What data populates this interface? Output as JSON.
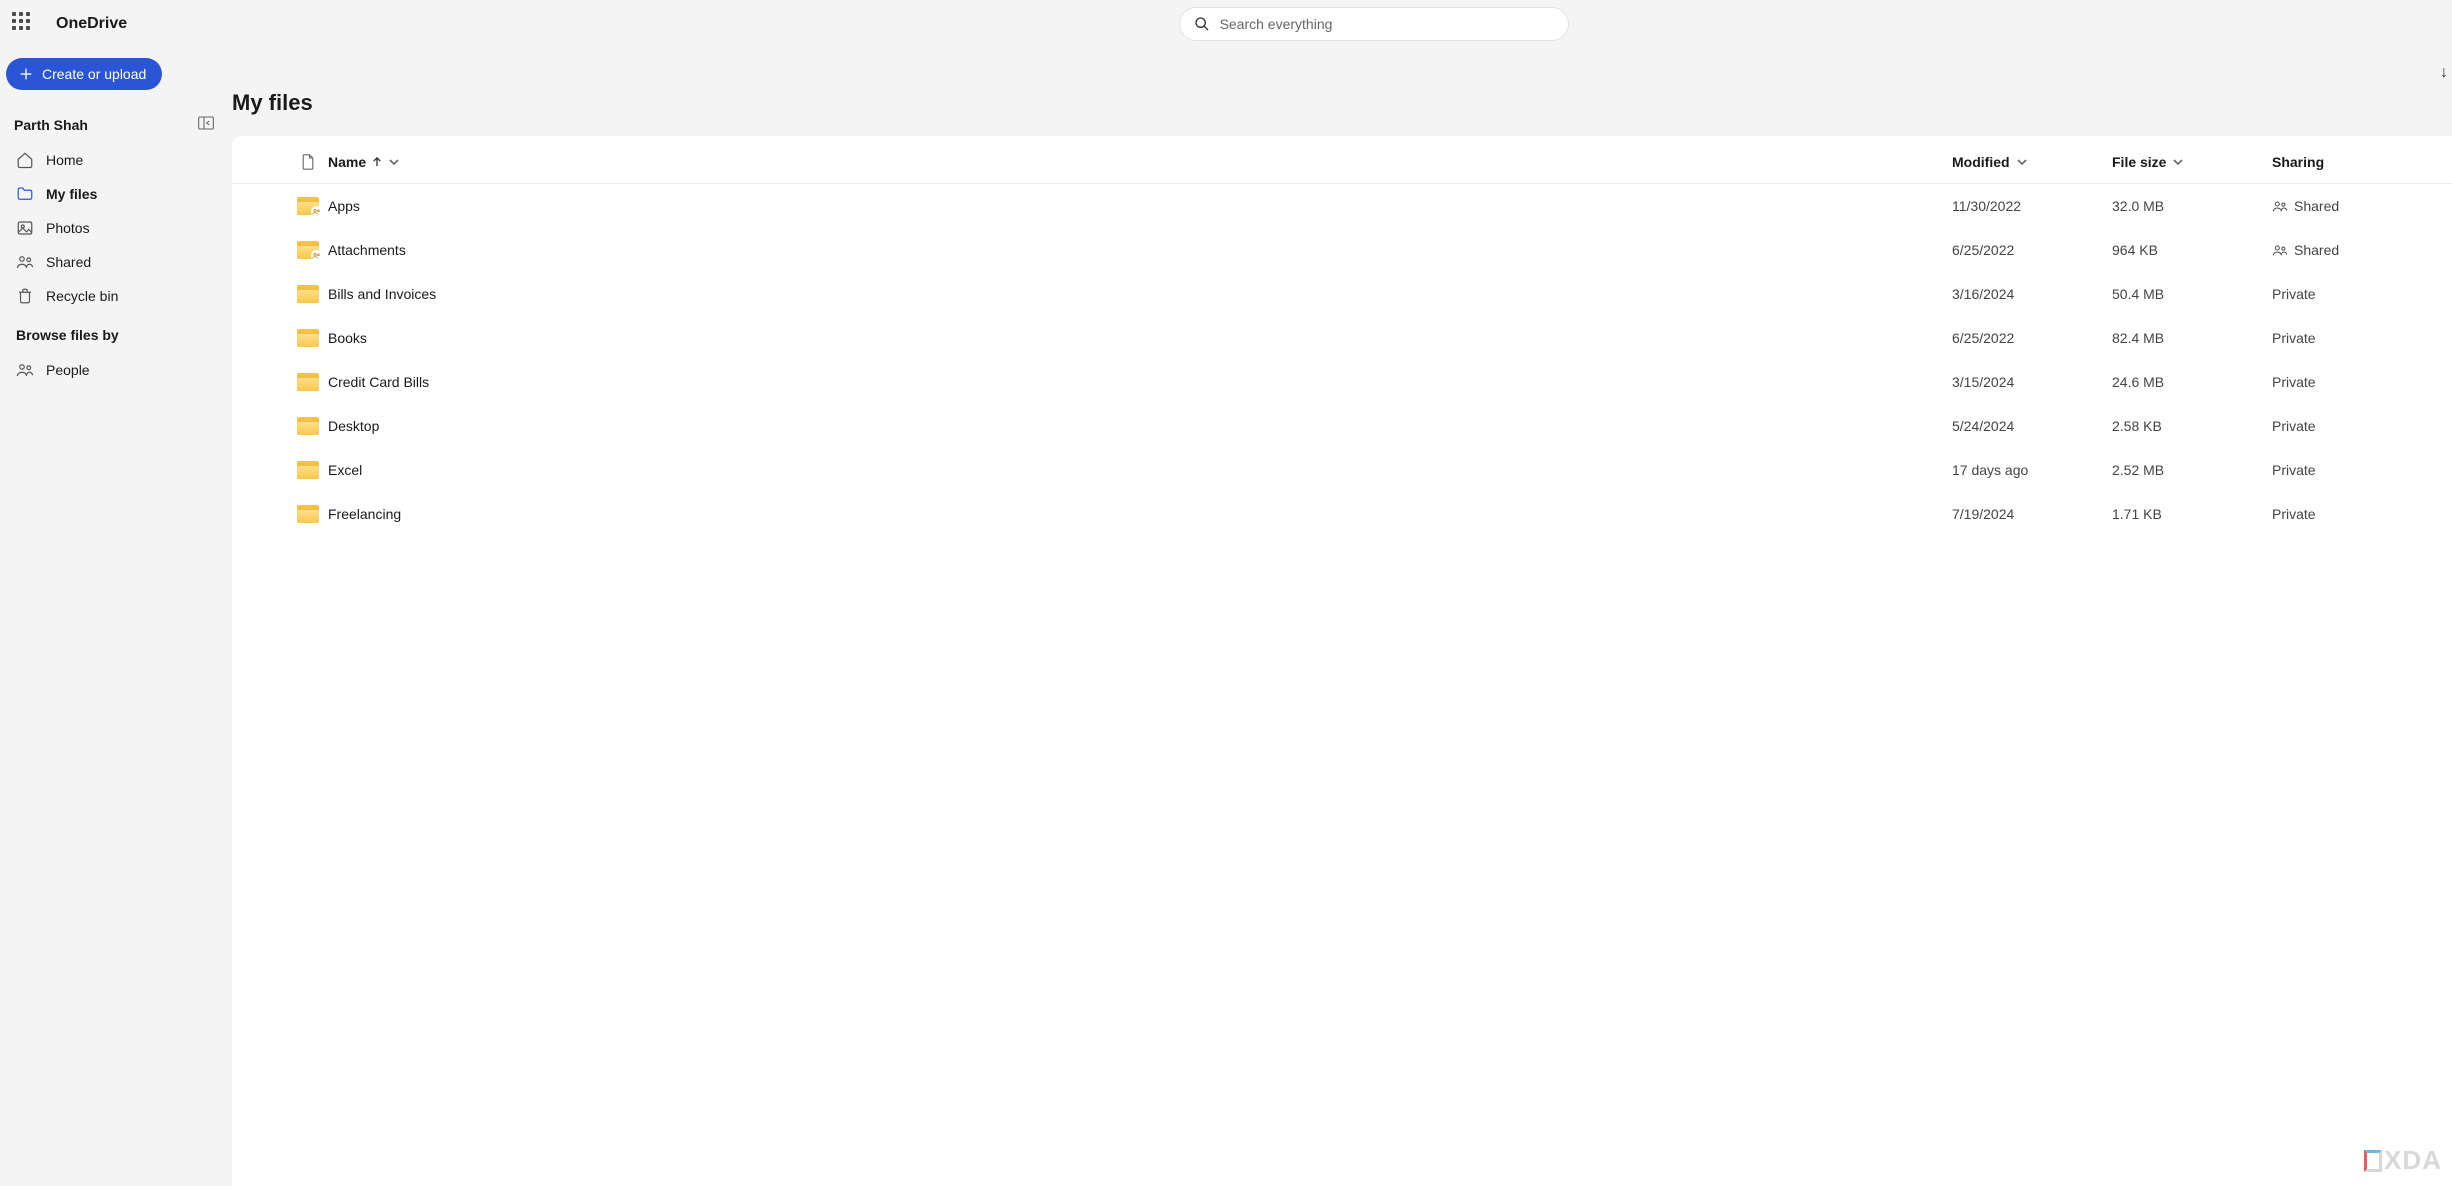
{
  "brand": "OneDrive",
  "search": {
    "placeholder": "Search everything"
  },
  "create_button": "Create or upload",
  "user": {
    "name": "Parth Shah"
  },
  "nav": {
    "items": [
      {
        "label": "Home",
        "icon": "home"
      },
      {
        "label": "My files",
        "icon": "folder",
        "active": true
      },
      {
        "label": "Photos",
        "icon": "photos"
      },
      {
        "label": "Shared",
        "icon": "shared"
      },
      {
        "label": "Recycle bin",
        "icon": "recycle"
      }
    ],
    "browse_title": "Browse files by",
    "browse_items": [
      {
        "label": "People",
        "icon": "people"
      }
    ]
  },
  "page": {
    "title": "My files"
  },
  "columns": {
    "name": "Name",
    "modified": "Modified",
    "size": "File size",
    "sharing": "Sharing"
  },
  "sharing_labels": {
    "shared": "Shared",
    "private": "Private"
  },
  "files": [
    {
      "name": "Apps",
      "modified": "11/30/2022",
      "size": "32.0 MB",
      "sharing": "shared",
      "shared_folder": true
    },
    {
      "name": "Attachments",
      "modified": "6/25/2022",
      "size": "964 KB",
      "sharing": "shared",
      "shared_folder": true
    },
    {
      "name": "Bills and Invoices",
      "modified": "3/16/2024",
      "size": "50.4 MB",
      "sharing": "private",
      "shared_folder": false
    },
    {
      "name": "Books",
      "modified": "6/25/2022",
      "size": "82.4 MB",
      "sharing": "private",
      "shared_folder": false
    },
    {
      "name": "Credit Card Bills",
      "modified": "3/15/2024",
      "size": "24.6 MB",
      "sharing": "private",
      "shared_folder": false
    },
    {
      "name": "Desktop",
      "modified": "5/24/2024",
      "size": "2.58 KB",
      "sharing": "private",
      "shared_folder": false
    },
    {
      "name": "Excel",
      "modified": "17 days ago",
      "size": "2.52 MB",
      "sharing": "private",
      "shared_folder": false
    },
    {
      "name": "Freelancing",
      "modified": "7/19/2024",
      "size": "1.71 KB",
      "sharing": "private",
      "shared_folder": false
    }
  ],
  "watermark": "XDA"
}
